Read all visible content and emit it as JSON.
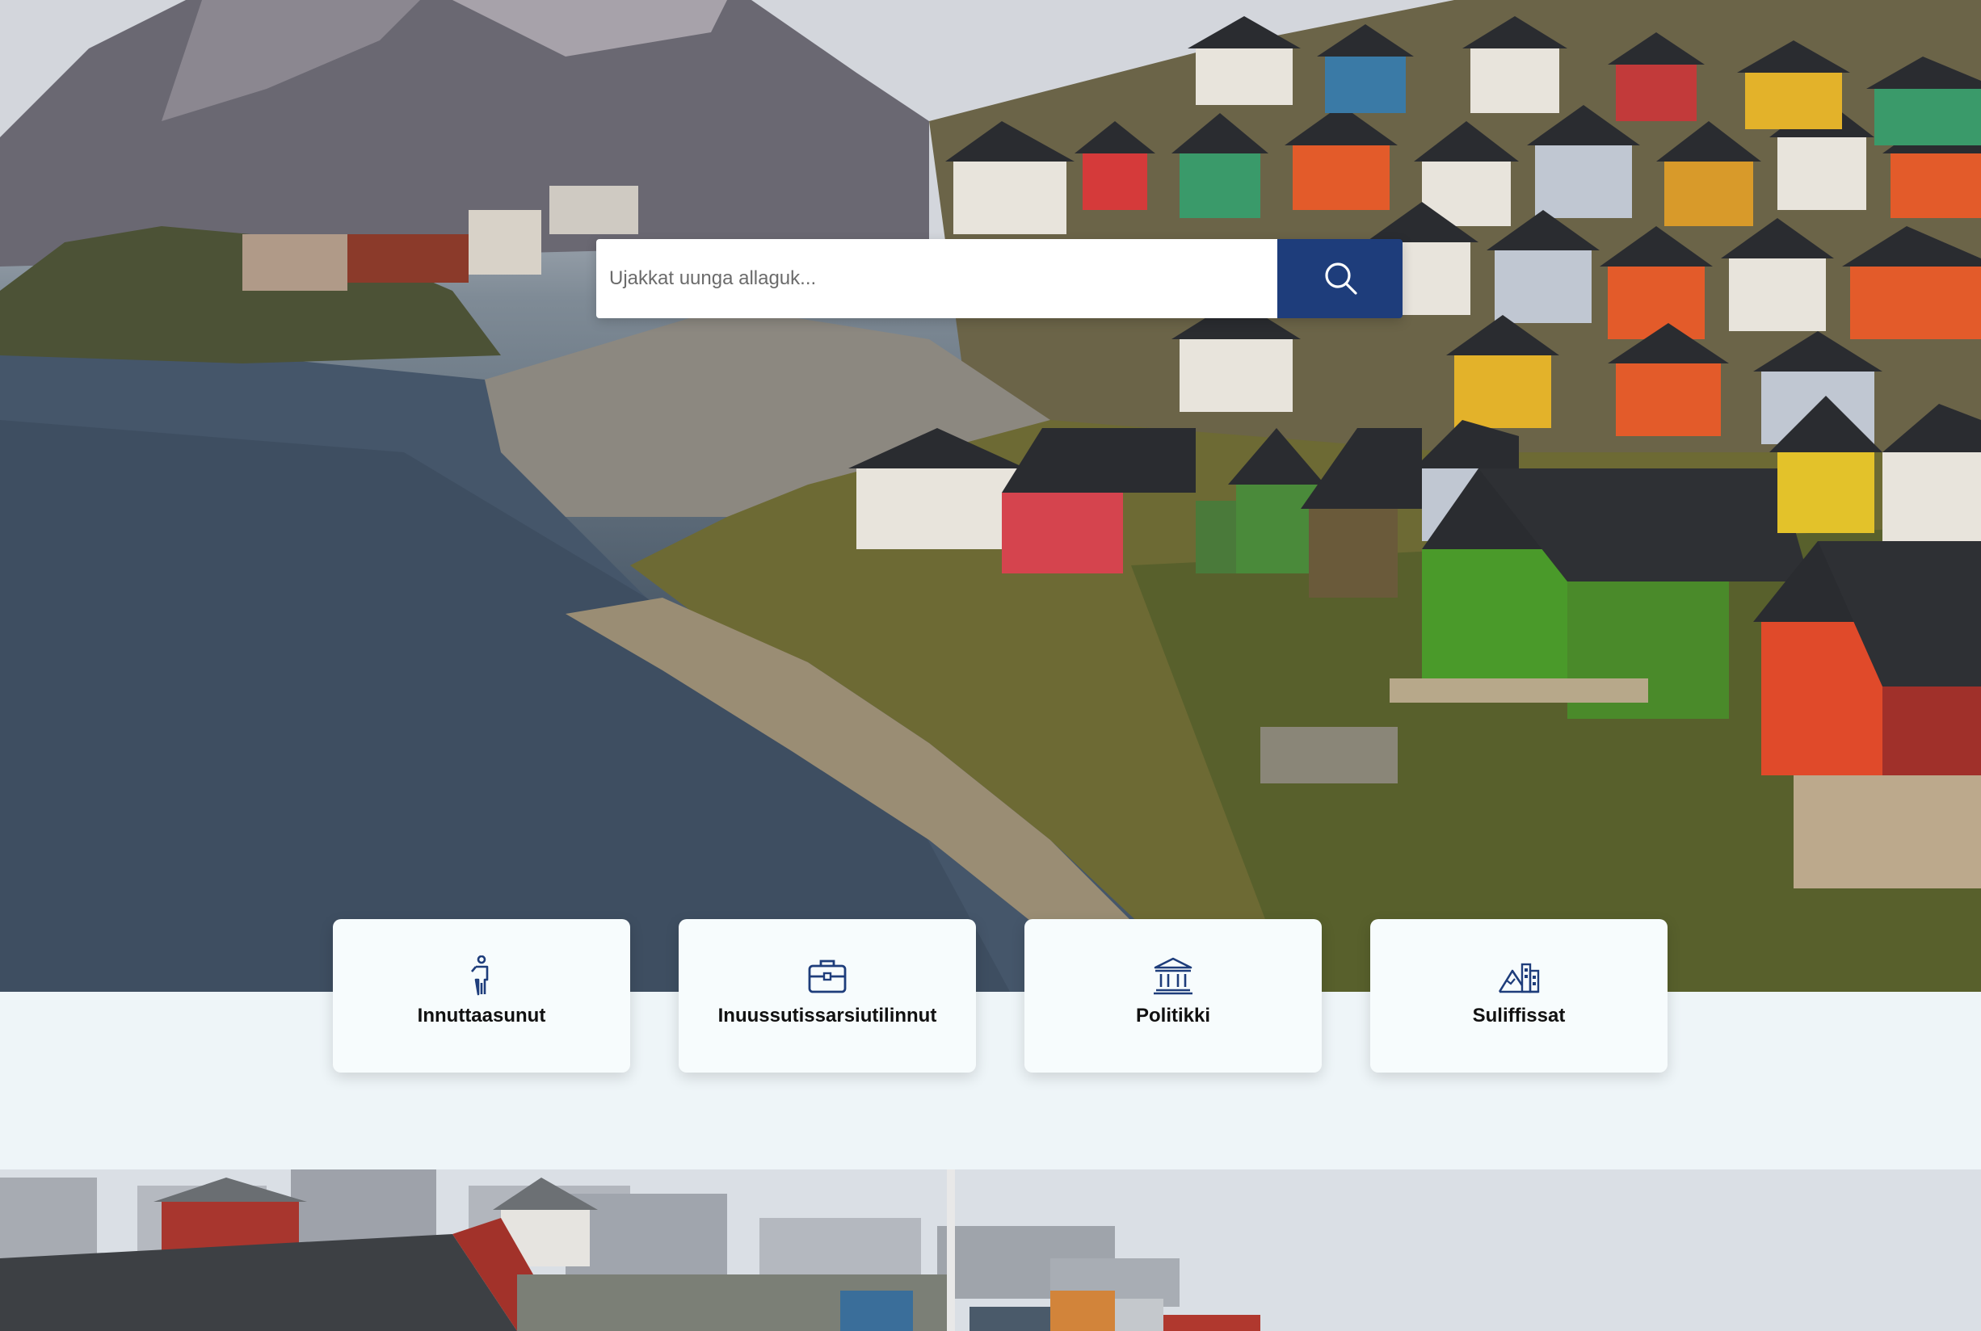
{
  "search": {
    "placeholder": "Ujakkat uunga allaguk...",
    "button_icon": "search-icon"
  },
  "categories": [
    {
      "label": "Innuttaasunut",
      "icon": "person-icon"
    },
    {
      "label": "Inuussutissarsiutilinnut",
      "icon": "briefcase-icon"
    },
    {
      "label": "Politikki",
      "icon": "bank-building-icon"
    },
    {
      "label": "Suliffissat",
      "icon": "mountain-buildings-icon"
    }
  ],
  "colors": {
    "primary": "#1e3d7b",
    "card_bg": "#f7fcfd",
    "page_bg": "#eef5f8"
  }
}
